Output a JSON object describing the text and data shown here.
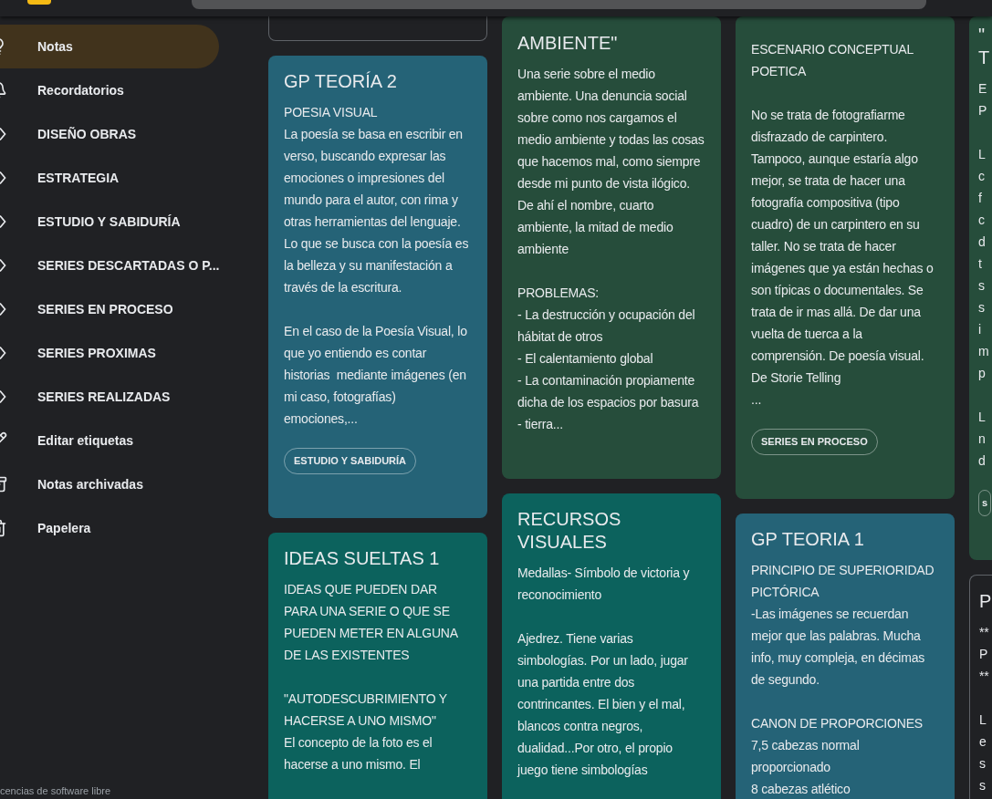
{
  "sidebar": {
    "items": [
      {
        "label": "Notas",
        "selected": true
      },
      {
        "label": "Recordatorios",
        "selected": false
      },
      {
        "label": "DISEÑO OBRAS",
        "selected": false
      },
      {
        "label": "ESTRATEGIA",
        "selected": false
      },
      {
        "label": "ESTUDIO Y SABIDURÍA",
        "selected": false
      },
      {
        "label": "SERIES DESCARTADAS O P...",
        "selected": false
      },
      {
        "label": "SERIES EN PROCESO",
        "selected": false
      },
      {
        "label": "SERIES PROXIMAS",
        "selected": false
      },
      {
        "label": "SERIES REALIZADAS",
        "selected": false
      },
      {
        "label": "Editar etiquetas",
        "selected": false
      },
      {
        "label": "Notas archivadas",
        "selected": false
      },
      {
        "label": "Papelera",
        "selected": false
      }
    ],
    "footer": "cencias de software libre"
  },
  "columns": [
    {
      "cards": [
        {
          "kind": "outlined"
        },
        {
          "kind": "colored",
          "color": "#256377",
          "title": "GP TEORÍA 2",
          "body": [
            "POESIA VISUAL\nLa poesía se basa en escribir en verso, buscando expresar las emociones o impresiones del mundo para el autor, con rima y otras herramientas del lenguaje. Lo que se busca con la poesía es la belleza y su manifestación a través de la escritura.",
            "En el caso de la Poesía Visual, lo que yo entiendo es contar historias  mediante imágenes (en mi caso, fotografías) emociones,..."
          ],
          "tag": "ESTUDIO Y SABIDURÍA"
        },
        {
          "kind": "colored",
          "color": "#0c625d",
          "title": "IDEAS SUELTAS 1",
          "body": [
            "IDEAS QUE PUEDEN DAR PARA UNA SERIE O QUE SE PUEDEN METER EN ALGUNA DE LAS EXISTENTES",
            "\"AUTODESCUBRIMIENTO Y HACERSE A UNO MISMO\"\nEl concepto de la foto es el hacerse a uno mismo. El"
          ]
        }
      ]
    },
    {
      "cards": [
        {
          "kind": "colored",
          "color": "#264d3b",
          "title": "AMBIENTE\"",
          "body": [
            "Una serie sobre el medio ambiente. Una denuncia social sobre como nos cargamos el medio ambiente y todas las cosas que hacemos mal, como siempre desde mi punto de vista ilógico. De ahí el nombre, cuarto ambiente, la mitad de medio ambiente",
            "PROBLEMAS:\n- La destrucción y ocupación del hábitat de otros\n- El calentamiento global\n- La contaminación propiamente dicha de los espacios por basura - tierra..."
          ]
        },
        {
          "kind": "colored",
          "color": "#0c625d",
          "title": "RECURSOS VISUALES",
          "body": [
            "Medallas- Símbolo de victoria y reconocimiento",
            "Ajedrez. Tiene varias simbologías. Por un lado, jugar una partida entre dos contrincantes. El bien y el mal, blancos contra negros, dualidad...Por otro, el propio juego tiene simbologías"
          ]
        }
      ]
    },
    {
      "cards": [
        {
          "kind": "colored",
          "color": "#264d3b",
          "body": [
            "ESCENARIO CONCEPTUAL POETICA",
            "No se trata de fotografiarme disfrazado de carpintero. Tampoco, aunque estaría algo mejor, se trata de hacer una fotografía compositiva (tipo cuadro) de un carpintero en su taller. No se trata de hacer imágenes que ya están hechas o son típicas o documentales. Se trata de ir mas allá. De dar una vuelta de tuerca a la comprensión. De poesía visual. De Storie Telling\n..."
          ],
          "tag": "SERIES EN PROCESO"
        },
        {
          "kind": "colored",
          "color": "#256377",
          "title": "GP TEORIA 1",
          "body": [
            "PRINCIPIO DE SUPERIORIDAD PICTÓRICA\n-Las imágenes se recuerdan mejor que las palabras. Mucha info, muy compleja, en décimas de segundo.",
            "CANON DE PROPORCIONES\n7,5 cabezas normal proporcionado\n8 cabezas atlético"
          ]
        }
      ]
    },
    {
      "cards": [
        {
          "kind": "colored",
          "color": "#264d3b",
          "title": "\"\nT",
          "body": [
            "E\nP",
            "L\nc\nf\nc\nd\nt\ns\ns\ni\nm\np",
            "L\nn\nd"
          ],
          "tag": "s"
        },
        {
          "kind": "outlined",
          "title": "P",
          "body": [
            "**\nP\n**",
            "L\ne\ns\ns"
          ]
        }
      ]
    }
  ]
}
